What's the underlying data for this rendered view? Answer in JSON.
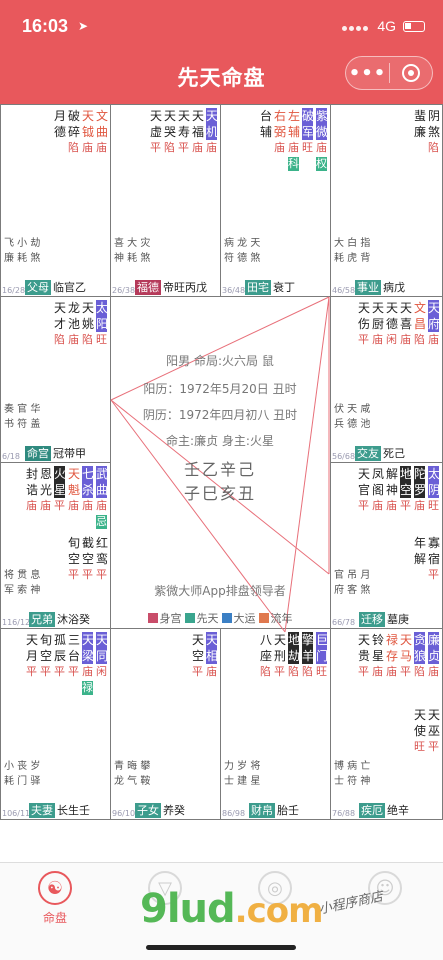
{
  "status": {
    "time": "16:03",
    "network": "4G"
  },
  "nav": {
    "title": "先天命盘"
  },
  "colors": {
    "accent": "#e8585c",
    "main_star_bg": "#6a5fd6",
    "hua_bg": "#3bb38a",
    "palace_tag": "#3d9c8d"
  },
  "palaces": [
    {
      "id": "p-si",
      "stars": [
        {
          "n": "文",
          "b": "庙",
          "c": "red"
        },
        {
          "n": "天",
          "b": "陷",
          "c": "red"
        },
        {
          "n": "破",
          "b": "陷"
        },
        {
          "n": "月",
          "b": ""
        },
        {
          "n": "德",
          "b": ""
        }
      ],
      "stars_simple": [
        "文曲",
        "天钺",
        "破碎",
        "月德"
      ],
      "minor": [
        "飞 小 劫",
        "廉 耗 煞"
      ],
      "age": "16/28",
      "name": "父母",
      "label": "临官乙"
    },
    {
      "id": "p-wu",
      "stars_simple": [
        "天机",
        "天福",
        "天寿",
        "天哭",
        "天虚"
      ],
      "minor": [
        "喜 大 灾",
        "神 耗 煞"
      ],
      "age": "26/38",
      "name": "福德",
      "label": "帝旺丙戊"
    },
    {
      "id": "p-wei",
      "stars_simple": [
        "紫微",
        "破军",
        "左辅",
        "右弼",
        "台辅"
      ],
      "minor": [
        "病 龙 天",
        "符 德 煞"
      ],
      "age": "36/48",
      "name": "田宅",
      "label": "衰丁"
    },
    {
      "id": "p-shen",
      "stars_simple": [
        "阴煞",
        "蜚廉"
      ],
      "minor": [
        "大 白 指",
        "耗 虎 背"
      ],
      "age": "46/58",
      "name": "事业",
      "label": "病戊"
    }
  ],
  "cells": {
    "top0": {
      "stars": [
        {
          "n": "文曲",
          "b": "庙",
          "c": "red"
        },
        {
          "n": "天钺",
          "b": "庙",
          "c": "red"
        },
        {
          "n": "破碎",
          "b": "陷"
        },
        {
          "n": "月德",
          "b": ""
        }
      ],
      "minor": [
        "飞 小 劫",
        "廉 耗 煞"
      ],
      "age": "16/28",
      "name": "父母",
      "label": "临官乙"
    },
    "top1": {
      "stars": [
        {
          "n": "天机",
          "b": "庙",
          "c": "main"
        },
        {
          "n": "天福",
          "b": "庙"
        },
        {
          "n": "天寿",
          "b": "平"
        },
        {
          "n": "天哭",
          "b": "陷"
        },
        {
          "n": "天虚",
          "b": "平"
        }
      ],
      "minor": [
        "喜 大 灾",
        "神 耗 煞"
      ],
      "age": "26/38",
      "name": "福德",
      "label": "帝旺丙戊"
    },
    "top2": {
      "stars": [
        {
          "n": "紫微",
          "b": "庙",
          "c": "main",
          "h": "权"
        },
        {
          "n": "破军",
          "b": "旺",
          "c": "main"
        },
        {
          "n": "左辅",
          "b": "庙",
          "c": "red",
          "h": "科"
        },
        {
          "n": "右弼",
          "b": "庙",
          "c": "red"
        },
        {
          "n": "台辅",
          "b": ""
        }
      ],
      "minor": [
        "病 龙 天",
        "符 德 煞"
      ],
      "age": "36/48",
      "name": "田宅",
      "label": "衰丁"
    },
    "top3": {
      "stars": [
        {
          "n": "阴煞",
          "b": "陷"
        },
        {
          "n": "蜚廉",
          "b": ""
        }
      ],
      "minor": [
        "大 白 指",
        "耗 虎 背"
      ],
      "age": "46/58",
      "name": "事业",
      "label": "病戊"
    },
    "l1": {
      "stars": [
        {
          "n": "太阳",
          "b": "旺",
          "c": "main"
        },
        {
          "n": "天姚",
          "b": "陷"
        },
        {
          "n": "龙池",
          "b": "庙"
        },
        {
          "n": "天才",
          "b": "陷"
        }
      ],
      "minor": [
        "奏 官 华",
        "书 符 盖"
      ],
      "age": "6/18",
      "name": "命宫",
      "label": "冠带甲"
    },
    "r1": {
      "stars": [
        {
          "n": "天府",
          "b": "庙",
          "c": "main"
        },
        {
          "n": "文昌",
          "b": "陷",
          "c": "red"
        },
        {
          "n": "天喜",
          "b": "庙"
        },
        {
          "n": "天德",
          "b": "闲"
        },
        {
          "n": "天厨",
          "b": "庙"
        },
        {
          "n": "天伤",
          "b": "平"
        }
      ],
      "minor": [
        "伏 天 咸",
        "兵 德 池"
      ],
      "age": "56/68",
      "name": "交友",
      "label": "死己"
    },
    "l2": {
      "stars": [
        {
          "n": "武曲",
          "b": "庙",
          "c": "main",
          "h": "忌"
        },
        {
          "n": "七杀",
          "b": "庙",
          "c": "main"
        },
        {
          "n": "天魁",
          "b": "庙",
          "c": "red"
        },
        {
          "n": "火星",
          "b": "平",
          "c": "dark"
        },
        {
          "n": "恩光",
          "b": "庙"
        },
        {
          "n": "封诰",
          "b": "庙"
        }
      ],
      "minor2": [
        {
          "n": "红鸾",
          "b": "平"
        },
        {
          "n": "截空",
          "b": "平"
        },
        {
          "n": "旬空",
          "b": "平"
        }
      ],
      "minor": [
        "将 贯 息",
        "军 索 神"
      ],
      "age": "116/128",
      "name": "兄弟",
      "label": "沐浴癸"
    },
    "r2": {
      "stars": [
        {
          "n": "太阴",
          "b": "旺",
          "c": "main"
        },
        {
          "n": "陀罗",
          "b": "庙",
          "c": "dark"
        },
        {
          "n": "地空",
          "b": "平",
          "c": "dark"
        },
        {
          "n": "解神",
          "b": "庙"
        },
        {
          "n": "凤阁",
          "b": "庙"
        },
        {
          "n": "天官",
          "b": "平"
        }
      ],
      "minor2": [
        {
          "n": "寡宿",
          "b": "平"
        },
        {
          "n": "年解",
          "b": ""
        }
      ],
      "minor": [
        "官 吊 月",
        "府 客 煞"
      ],
      "age": "66/78",
      "name": "迁移",
      "label": "墓庚"
    },
    "b0": {
      "stars": [
        {
          "n": "天同",
          "b": "闲",
          "c": "main"
        },
        {
          "n": "天梁",
          "b": "庙",
          "c": "main",
          "h": "禄"
        },
        {
          "n": "三台",
          "b": "平"
        },
        {
          "n": "孤辰",
          "b": "平"
        },
        {
          "n": "旬空",
          "b": "平"
        },
        {
          "n": "天月",
          "b": "平"
        }
      ],
      "minor": [
        "小 丧 岁",
        "耗 门 驿"
      ],
      "age": "106/118",
      "name": "夫妻",
      "label": "长生壬"
    },
    "b1": {
      "stars": [
        {
          "n": "天相",
          "b": "庙",
          "c": "main"
        },
        {
          "n": "天空",
          "b": "平"
        }
      ],
      "minor": [
        "青 晦 攀",
        "龙 气 鞍"
      ],
      "age": "96/108",
      "name": "子女",
      "label": "养癸"
    },
    "b2": {
      "stars": [
        {
          "n": "巨门",
          "b": "旺",
          "c": "main"
        },
        {
          "n": "擎羊",
          "b": "陷",
          "c": "dark"
        },
        {
          "n": "地劫",
          "b": "陷",
          "c": "dark"
        },
        {
          "n": "天刑",
          "b": "平"
        },
        {
          "n": "八座",
          "b": "陷"
        }
      ],
      "minor": [
        "力 岁 将",
        "士 建 星"
      ],
      "age": "86/98",
      "name": "财帛",
      "label": "胎壬"
    },
    "b3": {
      "stars": [
        {
          "n": "廉贞",
          "b": "庙",
          "c": "main"
        },
        {
          "n": "贪狼",
          "b": "陷",
          "c": "main"
        },
        {
          "n": "天马",
          "b": "平",
          "c": "red"
        },
        {
          "n": "禄存",
          "b": "庙",
          "c": "red"
        },
        {
          "n": "铃星",
          "b": "庙"
        },
        {
          "n": "天贵",
          "b": "平"
        }
      ],
      "minor2": [
        {
          "n": "天巫",
          "b": "平"
        },
        {
          "n": "天使",
          "b": "旺"
        }
      ],
      "minor": [
        "博 病 亡",
        "士 符 神"
      ],
      "age": "76/88",
      "name": "疾厄",
      "label": "绝辛"
    }
  },
  "center": {
    "line1": "阳男 命局:火六局 鼠",
    "line2": "阳历：1972年5月20日 丑时",
    "line3": "阴历：1972年四月初八 丑时",
    "line4": "命主:廉贞 身主:火星",
    "ganzhi1": "壬乙辛己",
    "ganzhi2": "子巳亥丑",
    "brand": "紫微大师App排盘领导者"
  },
  "legend": [
    {
      "label": "身宫",
      "color": "#c94d6a"
    },
    {
      "label": "先天",
      "color": "#3aa58e"
    },
    {
      "label": "大运",
      "color": "#3b7fc4"
    },
    {
      "label": "流年",
      "color": "#e0794f"
    }
  ],
  "tabbar": {
    "tab1": "命盘"
  },
  "watermark": {
    "brand": "9lud",
    "com": ".com",
    "hand": "小程序商店"
  }
}
